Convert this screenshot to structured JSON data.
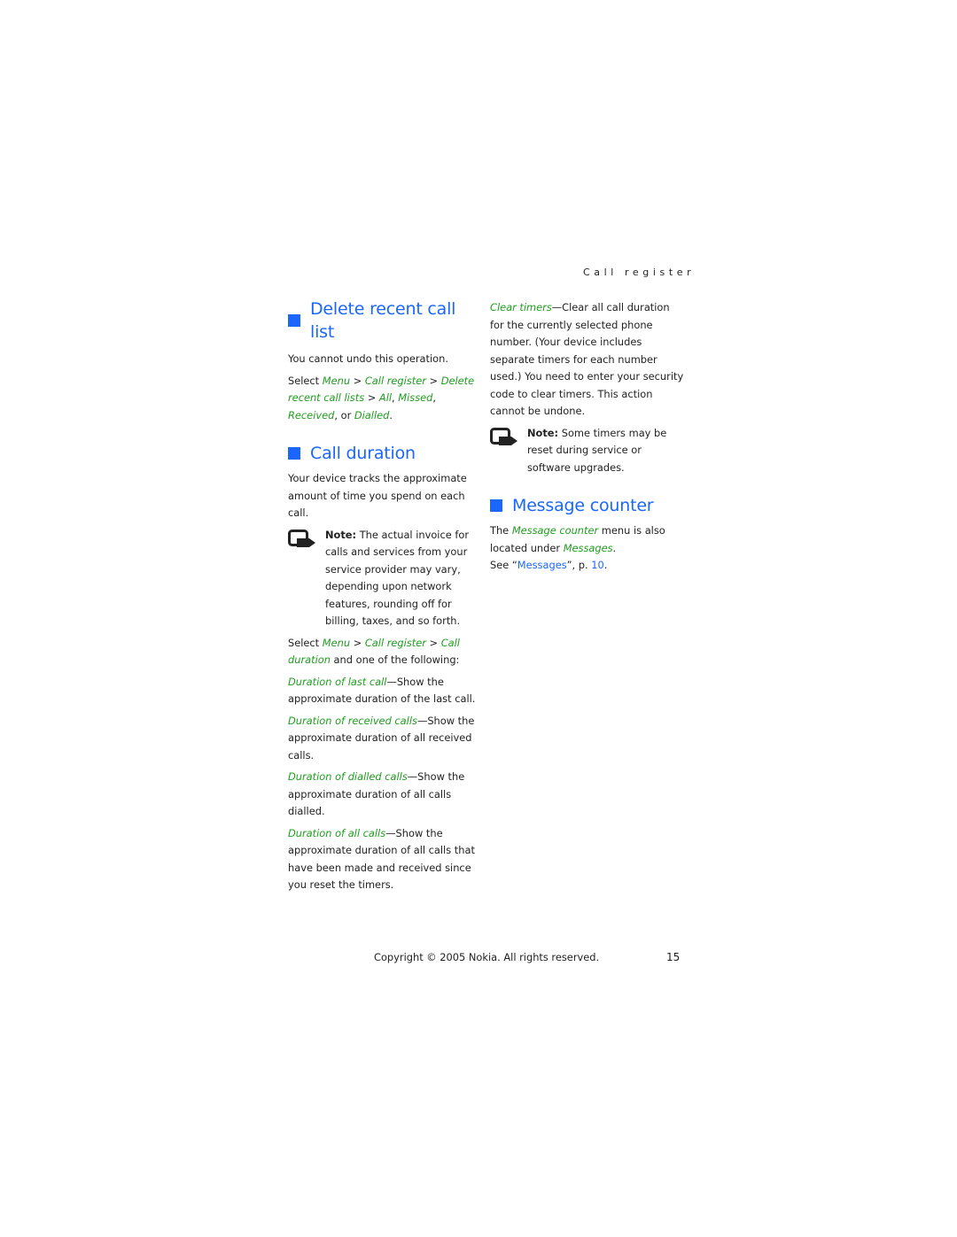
{
  "header": {
    "running_title": "Call register"
  },
  "sections": {
    "delete_recent": {
      "title": "Delete recent call list",
      "intro": "You cannot undo this operation.",
      "path": {
        "select": "Select ",
        "menu": "Menu",
        "sep": " > ",
        "call_register": "Call register",
        "delete_lists": "Delete recent call lists",
        "all": "All",
        "missed": "Missed",
        "received": "Received",
        "or": "or ",
        "dialled": "Dialled",
        "comma": ", ",
        "period": "."
      }
    },
    "call_duration": {
      "title": "Call duration",
      "intro": "Your device tracks the approximate amount of time you spend on each call.",
      "note_label": "Note:",
      "note_text": " The actual invoice for calls and services from your service provider may vary, depending upon network features, rounding off for billing, taxes, and so forth.",
      "path": {
        "select": "Select ",
        "menu": "Menu",
        "sep": " > ",
        "call_register": "Call register",
        "call_duration": "Call duration",
        "suffix": " and one of the following:"
      },
      "options": [
        {
          "name": "Duration of last call",
          "desc": "—Show the approximate duration of the last call."
        },
        {
          "name": "Duration of received calls",
          "desc": "—Show the approximate duration of all received calls."
        },
        {
          "name": "Duration of dialled calls",
          "desc": "—Show the approximate duration of all calls dialled."
        },
        {
          "name": "Duration of all calls",
          "desc": "—Show the approximate duration of all calls that have been made and received since you reset the timers."
        }
      ],
      "clear_timers": {
        "name": "Clear timers",
        "desc": "—Clear all call duration for the currently selected phone number. (Your device includes separate timers for each number used.) You need to enter your security code to clear timers. This action cannot be undone."
      },
      "note2_label": "Note:",
      "note2_text": " Some timers may be reset during service or software upgrades."
    },
    "message_counter": {
      "title": "Message counter",
      "the": "The ",
      "menu_name": "Message counter",
      "text1": " menu is also located under ",
      "messages": "Messages",
      "period": ".",
      "see": "See “",
      "see_link": "Messages",
      "see_mid": "”, p. ",
      "page_ref": "10",
      "see_end": "."
    }
  },
  "footer": {
    "copyright": "Copyright © 2005 Nokia. All rights reserved.",
    "page_number": "15"
  },
  "colors": {
    "heading_blue": "#1a66ff",
    "menu_green": "#1f9e1f"
  },
  "icons": {
    "note": "note-hand-icon"
  }
}
